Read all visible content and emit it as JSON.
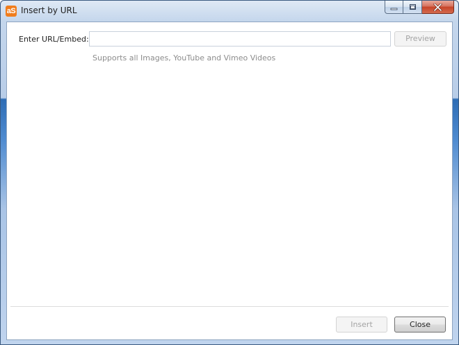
{
  "window": {
    "title": "Insert by URL",
    "app_icon_text": "aS",
    "accent_color": "#f07d1d"
  },
  "form": {
    "url_label": "Enter URL/Embed:",
    "url_value": "",
    "url_placeholder": "",
    "preview_label": "Preview",
    "hint": "Supports all Images, YouTube and Vimeo Videos"
  },
  "footer": {
    "insert_label": "Insert",
    "close_label": "Close"
  },
  "icons": {
    "minimize": "minimize-icon",
    "maximize": "maximize-icon",
    "close": "close-icon"
  }
}
